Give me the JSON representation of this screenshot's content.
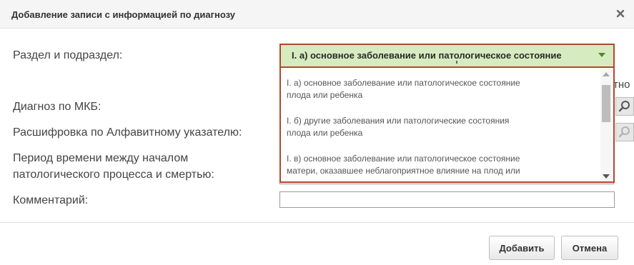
{
  "dialog": {
    "title": "Добавление записи с информацией по диагнозу",
    "close_icon": "close-icon"
  },
  "form": {
    "section_label": "Раздел и подраздел:",
    "mkb_label": "Диагноз по МКБ:",
    "alphabet_label": "Расшифровка по Алфавитному указателю:",
    "period_label_line1": "Период времени между началом",
    "period_label_line2": "патологического процесса и смертью:",
    "comment_label": "Комментарий:",
    "truncated_text": "тно"
  },
  "section_select": {
    "selected": "I. а) основное заболевание или патологическое состояние",
    "options": [
      {
        "line1": "I. а) основное заболевание или патологическое состояние",
        "line2": "плода или ребенка"
      },
      {
        "line1": "I. б) другие заболевания или патологические состояния",
        "line2": "плода или ребенка"
      },
      {
        "line1": "I. в) основное заболевание или патологическое состояние",
        "line2": "матери, оказавшее неблагоприятное влияние на плод или"
      }
    ]
  },
  "buttons": {
    "add": "Добавить",
    "cancel": "Отмена"
  },
  "colors": {
    "dropdown_border": "#b0482c",
    "selected_bg": "#d6ecc0"
  }
}
